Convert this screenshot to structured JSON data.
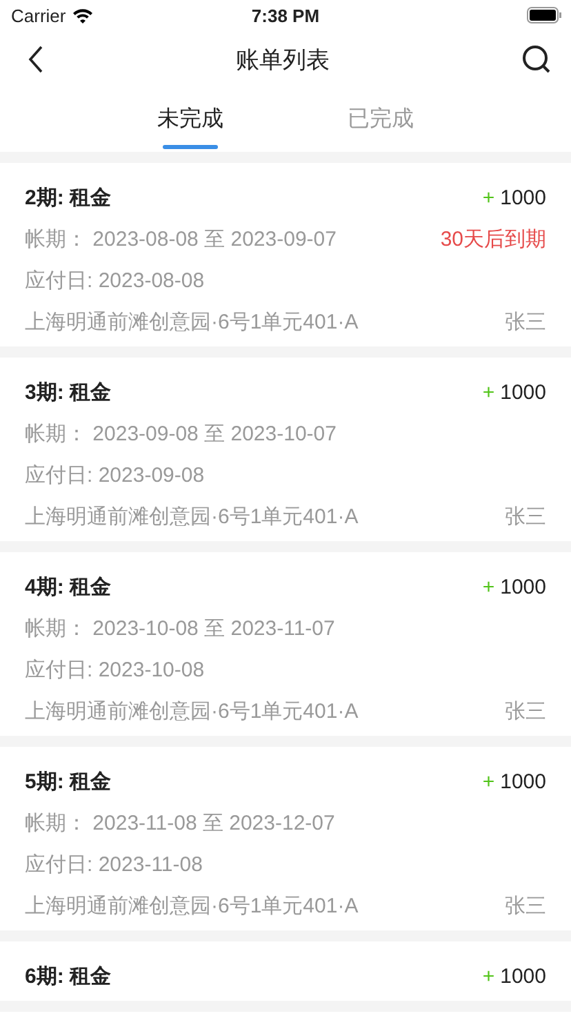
{
  "status_bar": {
    "carrier": "Carrier",
    "time": "7:38 PM"
  },
  "nav": {
    "title": "账单列表"
  },
  "tabs": [
    {
      "label": "未完成",
      "selected": true
    },
    {
      "label": "已完成",
      "selected": false
    }
  ],
  "bills": [
    {
      "title": "2期: 租金",
      "sign": "+",
      "amount": "1000",
      "period": "帐期： 2023-08-08 至 2023-09-07",
      "due_note": "30天后到期",
      "due_date": "应付日: 2023-08-08",
      "address": "上海明通前滩创意园·6号1单元401·A",
      "tenant": "张三"
    },
    {
      "title": "3期: 租金",
      "sign": "+",
      "amount": "1000",
      "period": "帐期： 2023-09-08 至 2023-10-07",
      "due_date": "应付日: 2023-09-08",
      "address": "上海明通前滩创意园·6号1单元401·A",
      "tenant": "张三"
    },
    {
      "title": "4期: 租金",
      "sign": "+",
      "amount": "1000",
      "period": "帐期： 2023-10-08 至 2023-11-07",
      "due_date": "应付日: 2023-10-08",
      "address": "上海明通前滩创意园·6号1单元401·A",
      "tenant": "张三"
    },
    {
      "title": "5期: 租金",
      "sign": "+",
      "amount": "1000",
      "period": "帐期： 2023-11-08 至 2023-12-07",
      "due_date": "应付日: 2023-11-08",
      "address": "上海明通前滩创意园·6号1单元401·A",
      "tenant": "张三"
    },
    {
      "title": "6期: 租金",
      "sign": "+",
      "amount": "1000"
    }
  ]
}
